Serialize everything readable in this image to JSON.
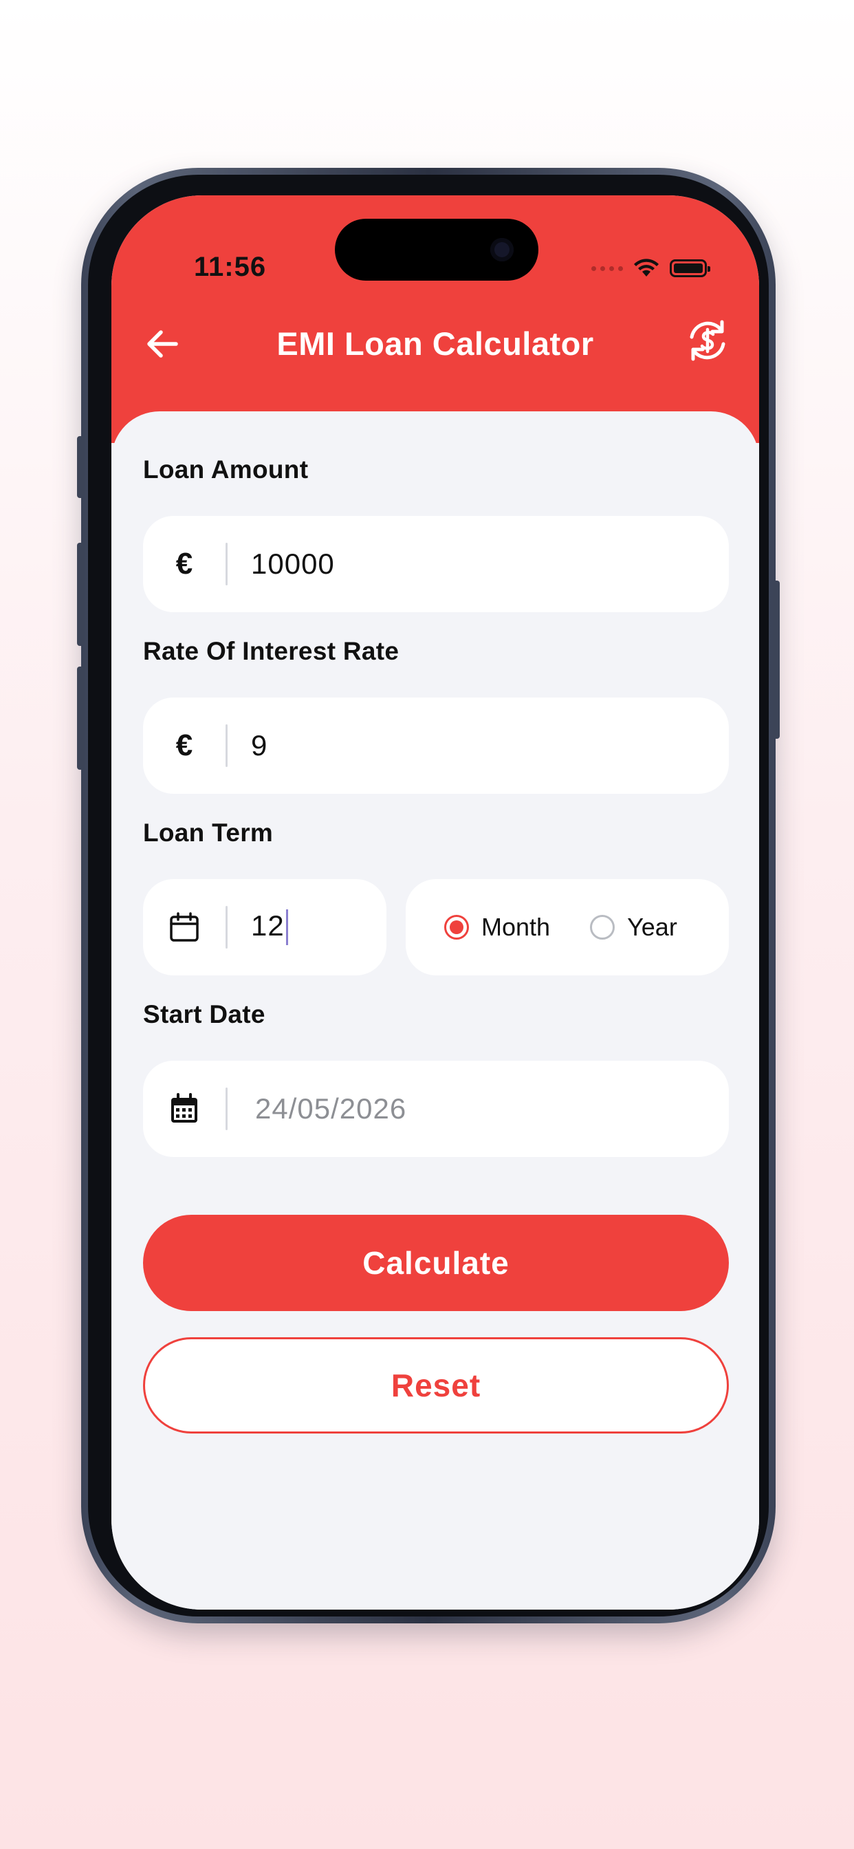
{
  "status_bar": {
    "time": "11:56"
  },
  "header": {
    "title": "EMI Loan Calculator",
    "back_icon": "arrow-left-icon",
    "refresh_icon": "currency-refresh-icon",
    "accent_color": "#ef413d"
  },
  "form": {
    "loan_amount": {
      "label": "Loan Amount",
      "currency_symbol": "€",
      "value": "10000"
    },
    "interest_rate": {
      "label": "Rate Of Interest Rate",
      "currency_symbol": "€",
      "value": "9"
    },
    "loan_term": {
      "label": "Loan Term",
      "value": "12",
      "options": [
        {
          "label": "Month",
          "selected": true
        },
        {
          "label": "Year",
          "selected": false
        }
      ]
    },
    "start_date": {
      "label": "Start Date",
      "placeholder": "24/05/2026"
    }
  },
  "actions": {
    "calculate_label": "Calculate",
    "reset_label": "Reset"
  }
}
